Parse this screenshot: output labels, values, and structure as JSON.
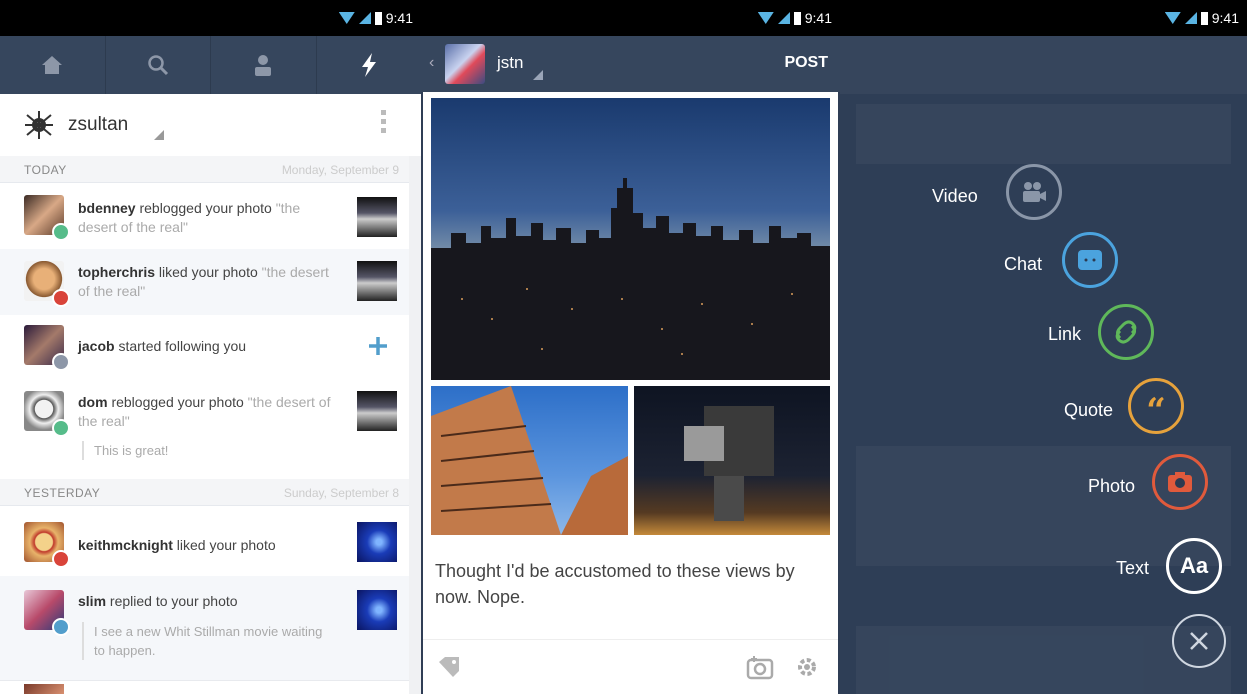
{
  "status_bar": {
    "time": "9:41"
  },
  "screen1": {
    "nav": {
      "tabs": [
        {
          "icon": "home-icon"
        },
        {
          "icon": "search-icon"
        },
        {
          "icon": "person-icon"
        },
        {
          "icon": "lightning-icon"
        }
      ]
    },
    "blog_name": "zsultan",
    "sections": {
      "today": {
        "label": "TODAY",
        "date": "Monday, September 9"
      },
      "yesterday": {
        "label": "YESTERDAY",
        "date": "Sunday, September 8"
      }
    },
    "notifications": [
      {
        "user": "bdenney",
        "action": " reblogged your photo",
        "quote": "\"the desert of the real\""
      },
      {
        "user": "topherchris",
        "action": " liked your photo",
        "quote": " \"the desert of the real\""
      },
      {
        "user": "jacob",
        "action": " started following you"
      },
      {
        "user": "dom",
        "action": " reblogged your photo",
        "quote": " \"the desert of the real\"",
        "reply": "This is great!"
      },
      {
        "user": "keithmcknight",
        "action": " liked your photo"
      },
      {
        "user": "slim",
        "action": " replied to your photo",
        "reply": "I see a new Whit Stillman movie waiting to happen."
      }
    ]
  },
  "screen2": {
    "blog_name": "jstn",
    "post_label": "POST",
    "caption": "Thought I'd be accustomed to these views by now. Nope."
  },
  "screen3": {
    "options": [
      {
        "label": "Video",
        "color": "#8a96a8"
      },
      {
        "label": "Chat",
        "color": "#4ba3de"
      },
      {
        "label": "Link",
        "color": "#5fb85a"
      },
      {
        "label": "Quote",
        "color": "#e6a23c"
      },
      {
        "label": "Photo",
        "color": "#e05a3c"
      },
      {
        "label": "Text",
        "color": "#ffffff",
        "glyph": "Aa"
      }
    ]
  },
  "colors": {
    "nav_bg": "#36465d",
    "accent_blue": "#529ecc",
    "heart_red": "#d9443a",
    "reblog_green": "#56bc8a"
  }
}
